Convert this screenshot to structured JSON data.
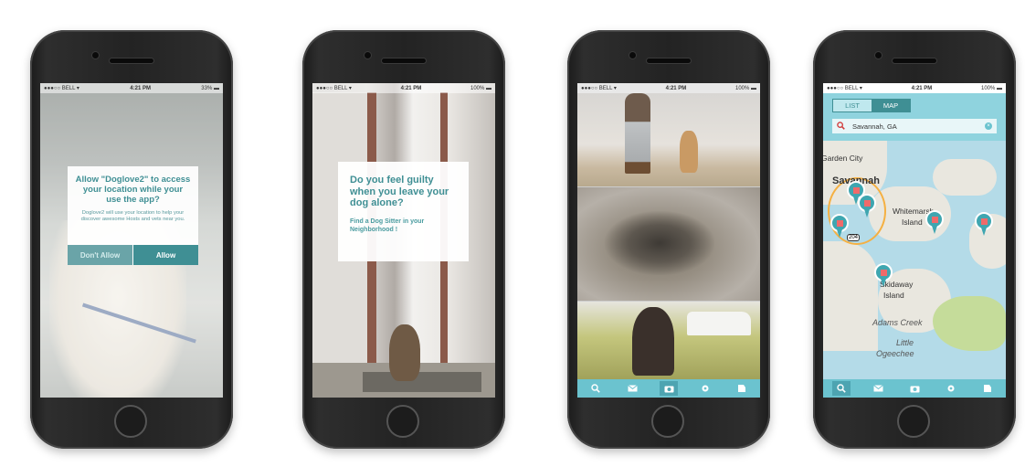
{
  "screens": {
    "one": {
      "status": {
        "carrier": "●●●○○ BELL ▾",
        "time": "4:21 PM",
        "battery": "33% ▬"
      },
      "dialog": {
        "title": "Allow \"Doglove2\" to access your location while your use the app?",
        "body": "Doglove2 will use your location to help your discover awesome Hosts and vets near you.",
        "deny_label": "Don't Allow",
        "allow_label": "Allow"
      }
    },
    "two": {
      "status": {
        "carrier": "●●●○○ BELL ▾",
        "time": "4:21 PM",
        "battery": "100% ▬"
      },
      "card": {
        "title": "Do you feel guilty when you leave your dog alone?",
        "subtitle": "Find a Dog Sitter in your Neighborhood !"
      }
    },
    "three": {
      "status": {
        "carrier": "●●●○○ BELL ▾",
        "time": "4:21 PM",
        "battery": "100% ▬"
      }
    },
    "four": {
      "status": {
        "carrier": "●●●○○ BELL ▾",
        "time": "4:21 PM",
        "battery": "100% ▬"
      },
      "toggle": {
        "list_label": "LIST",
        "map_label": "MAP"
      },
      "search": {
        "value": "Savannah, GA"
      },
      "map_labels": {
        "city": "Garden City",
        "savannah": "Savannah",
        "whitemarsh": "Whitemarsh",
        "island": "Island",
        "skidaway": "Skidaway",
        "skidaway_island": "Island",
        "adams_creek": "Adams Creek",
        "little": "Little",
        "ogeechee": "Ogeechee",
        "route": "204"
      }
    }
  },
  "tabbar": {
    "icons": [
      "search-icon",
      "mail-icon",
      "camera-icon",
      "settings-icon",
      "profile-icon"
    ]
  },
  "colors": {
    "teal": "#3f8f94",
    "tab": "#6bc3cf",
    "pin_accent": "#f06a6a"
  }
}
